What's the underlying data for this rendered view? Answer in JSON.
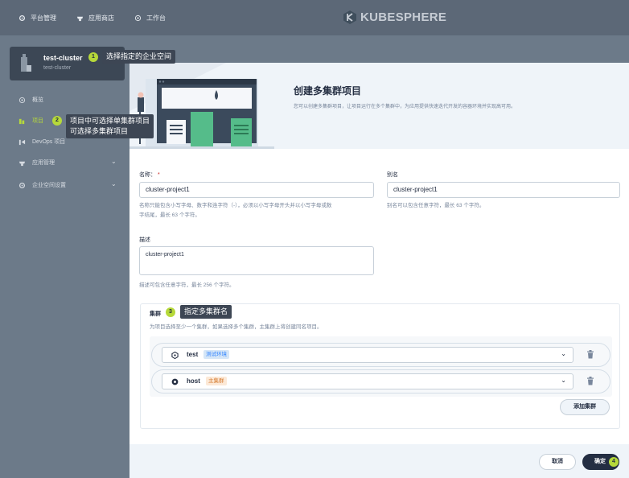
{
  "topbar": {
    "nav": [
      {
        "label": "平台管理",
        "icon": "gear-icon"
      },
      {
        "label": "应用商店",
        "icon": "store-icon"
      },
      {
        "label": "工作台",
        "icon": "dashboard-icon"
      }
    ],
    "brand": "KUBESPHERE"
  },
  "workspace": {
    "name": "test-cluster",
    "subtitle": "test-cluster"
  },
  "sidebar": {
    "items": [
      {
        "label": "概览",
        "icon": "overview-icon"
      },
      {
        "label": "项目",
        "icon": "project-icon"
      },
      {
        "label": "DevOps 项目",
        "icon": "devops-icon"
      },
      {
        "label": "应用管理",
        "icon": "app-icon"
      },
      {
        "label": "企业空间设置",
        "icon": "settings-icon"
      }
    ]
  },
  "annotations": {
    "step1": {
      "num": "1",
      "text": "选择指定的企业空间"
    },
    "step2": {
      "num": "2",
      "line1": "项目中可选择单集群项目",
      "line2": "可选择多集群项目"
    },
    "step3": {
      "num": "3",
      "text": "指定多集群名"
    },
    "step4": {
      "num": "4"
    }
  },
  "modal": {
    "title": "创建多集群项目",
    "description": "您可以创建多集群项目，让项目运行在多个集群中，为应用提供快速迭代开发的容器环境并实现高可用。",
    "form": {
      "name_label": "名称",
      "name_required": "*",
      "name_value": "cluster-project1",
      "name_hint_1": "名称只能包含小写字母、数字和连字符（-），必须以小写字母开头并以小写字母或数",
      "name_hint_2": "字结尾，最长 63 个字符。",
      "alias_label": "别名",
      "alias_value": "cluster-project1",
      "alias_hint": "别名可以包含任意字符，最长 63 个字符。",
      "desc_label": "描述",
      "desc_value": "cluster-project1",
      "desc_hint": "描述可包含任意字符，最长 256 个字符。"
    },
    "clusters": {
      "title": "集群",
      "description": "为项目选择至少一个集群，如果选择多个集群，主集群上将创建同名项目。",
      "rows": [
        {
          "name": "test",
          "badge": "测试环境",
          "badge_color": "#d5e6f7",
          "badge_text_color": "#3385ff"
        },
        {
          "name": "host",
          "badge": "主集群",
          "badge_color": "#fce9d7",
          "badge_text_color": "#d57b30"
        }
      ],
      "add_button": "添加集群"
    },
    "footer": {
      "cancel": "取消",
      "confirm": "确定"
    }
  },
  "colors": {
    "accent": "#b6d93a",
    "primary_dark": "#242e42"
  }
}
